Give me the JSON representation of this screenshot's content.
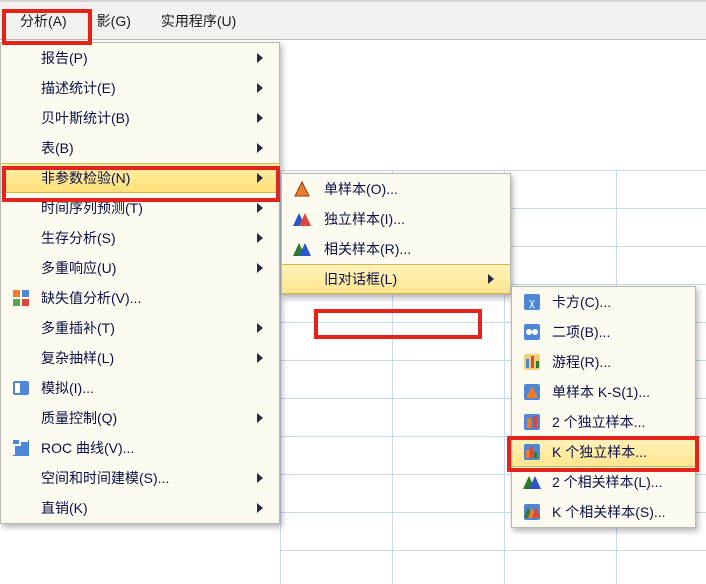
{
  "menubar": {
    "analyze": "分析(A)",
    "graphs": "影(G)",
    "utilities": "实用程序(U)"
  },
  "menu1": {
    "reports": "报告(P)",
    "descriptives": "描述统计(E)",
    "bayes": "贝叶斯统计(B)",
    "tables": "表(B)",
    "nonparametric": "非参数检验(N)",
    "timeseries": "时间序列预测(T)",
    "survival": "生存分析(S)",
    "multiresp": "多重响应(U)",
    "missing": "缺失值分析(V)...",
    "multimputation": "多重插补(T)",
    "complex": "复杂抽样(L)",
    "simulation": "模拟(I)...",
    "quality": "质量控制(Q)",
    "roc": "ROC 曲线(V)...",
    "spacetime": "空间和时间建模(S)...",
    "direct": "直销(K)"
  },
  "menu2": {
    "onesample": "单样本(O)...",
    "independent": "独立样本(I)...",
    "related": "相关样本(R)...",
    "legacy": "旧对话框(L)"
  },
  "menu3": {
    "chisq": "卡方(C)...",
    "binomial": "二项(B)...",
    "runs": "游程(R)...",
    "ks1": "单样本 K-S(1)...",
    "indep2": "2 个独立样本...",
    "indepk": "K 个独立样本...",
    "rel2": "2 个相关样本(L)...",
    "relk": "K 个相关样本(S)..."
  },
  "icons": {
    "orange_tri": "orange-triangle-icon",
    "blue_tri": "blue-triangle-icon",
    "green_tri": "green-triangle-icon",
    "bars": "bar-chart-icon",
    "mosaic": "mosaic-icon",
    "sim": "simulation-icon",
    "ruler": "ruler-icon",
    "roc": "roc-icon",
    "chi": "chi-icon",
    "bi": "binomial-icon",
    "runs": "runs-icon",
    "ks": "ks-icon",
    "i2": "two-bars-icon",
    "ik": "k-bars-icon",
    "r2": "two-related-icon",
    "rk": "k-related-icon"
  }
}
